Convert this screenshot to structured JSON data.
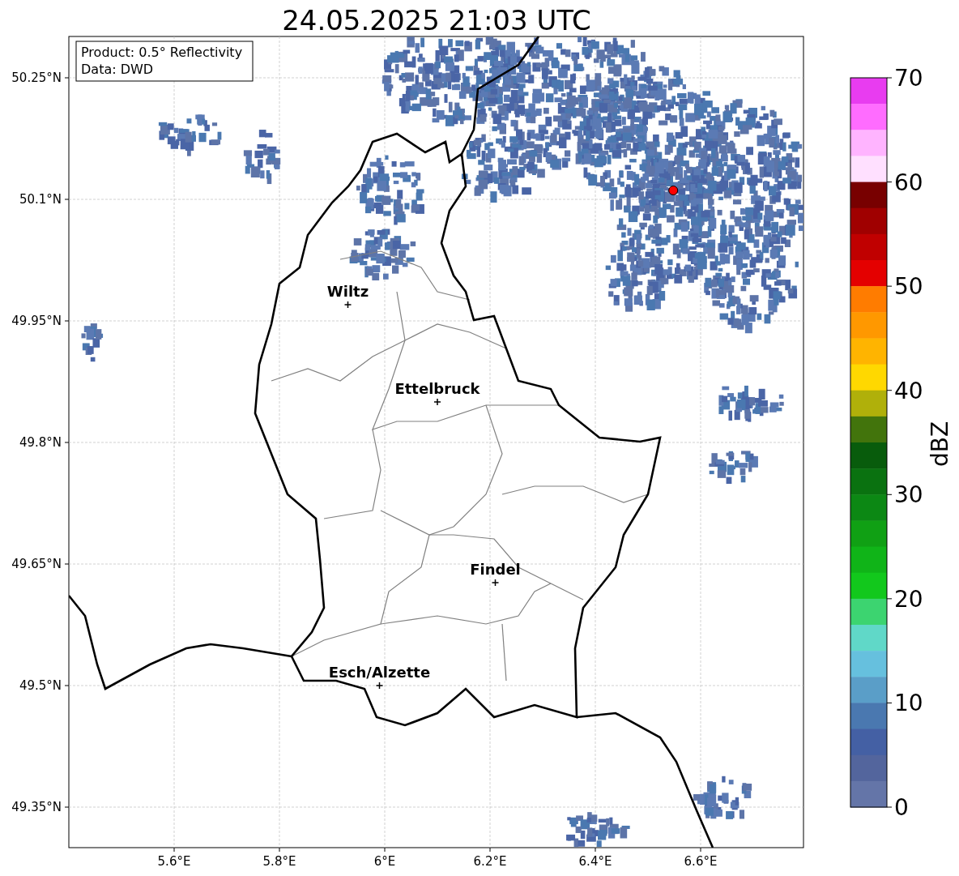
{
  "title": "24.05.2025 21:03 UTC",
  "info_box": [
    "Product: 0.5° Reflectivity",
    "Data: DWD"
  ],
  "x_axis": {
    "ticks": [
      "5.6°E",
      "5.8°E",
      "6°E",
      "6.2°E",
      "6.4°E",
      "6.6°E"
    ]
  },
  "y_axis": {
    "ticks": [
      "50.25°N",
      "50.1°N",
      "49.95°N",
      "49.8°N",
      "49.65°N",
      "49.5°N",
      "49.35°N"
    ]
  },
  "places": [
    {
      "name": "Wiltz"
    },
    {
      "name": "Ettelbruck"
    },
    {
      "name": "Findel"
    },
    {
      "name": "Esch/Alzette"
    }
  ],
  "radar_site": {
    "color": "#ff0000"
  },
  "colorbar": {
    "label": "dBZ",
    "ticks": [
      "70",
      "60",
      "50",
      "40",
      "30",
      "20",
      "10",
      "0"
    ],
    "bins": [
      {
        "color": "#e83cf0"
      },
      {
        "color": "#ff6cff"
      },
      {
        "color": "#ffb4ff"
      },
      {
        "color": "#ffe0ff"
      },
      {
        "color": "#780000"
      },
      {
        "color": "#a00000"
      },
      {
        "color": "#c00000"
      },
      {
        "color": "#e40000"
      },
      {
        "color": "#ff7c00"
      },
      {
        "color": "#ff9800"
      },
      {
        "color": "#ffb400"
      },
      {
        "color": "#ffd800"
      },
      {
        "color": "#b0b00a"
      },
      {
        "color": "#42740c"
      },
      {
        "color": "#085c0c"
      },
      {
        "color": "#0a7210"
      },
      {
        "color": "#0c8814"
      },
      {
        "color": "#10a014"
      },
      {
        "color": "#10b418"
      },
      {
        "color": "#12c81c"
      },
      {
        "color": "#3cd470"
      },
      {
        "color": "#60d8c8"
      },
      {
        "color": "#66c0de"
      },
      {
        "color": "#5a9ec8"
      },
      {
        "color": "#4a78b0"
      },
      {
        "color": "#4460a4"
      },
      {
        "color": "#53659d"
      },
      {
        "color": "#6475a8"
      }
    ]
  }
}
